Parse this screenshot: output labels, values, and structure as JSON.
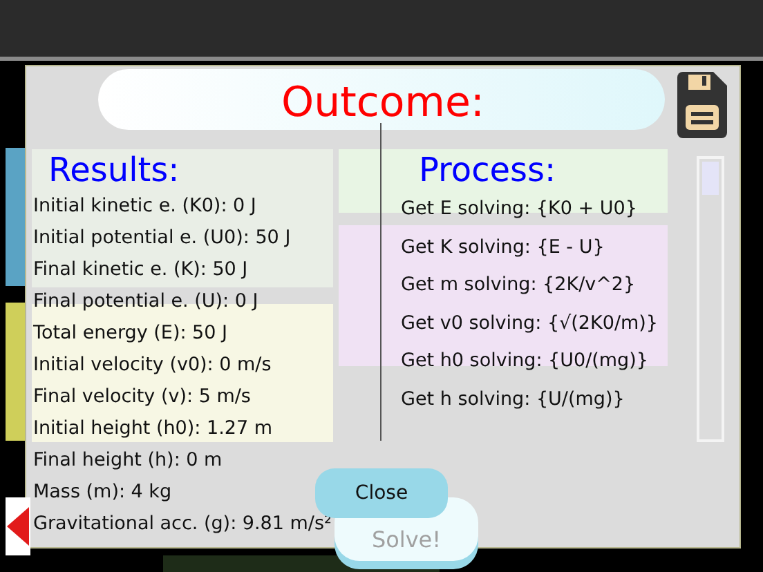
{
  "app": {
    "solve_button": "Solve!"
  },
  "dialog": {
    "title": "Outcome:",
    "results": {
      "heading": "Results:",
      "lines": [
        "Initial kinetic e. (K0): 0 J",
        "Initial potential e. (U0): 50 J",
        "Final kinetic e. (K): 50 J",
        "Final potential e. (U): 0 J",
        "Total energy (E): 50 J",
        "Initial velocity (v0): 0 m/s",
        "Final velocity (v): 5 m/s",
        "Initial height (h0): 1.27 m",
        "Final height (h): 0 m",
        "Mass (m): 4 kg",
        "Gravitational acc. (g): 9.81 m/s²"
      ]
    },
    "process": {
      "heading": "Process:",
      "lines": [
        "Get E solving: {K0 + U0}",
        "Get K solving: {E - U}",
        "Get m solving: {2K/v^2}",
        "Get v0 solving: {√(2K0/m)}",
        "Get h0 solving: {U0/(mg)}",
        "Get h solving: {U/(mg)}"
      ]
    },
    "close_button": "Close"
  }
}
